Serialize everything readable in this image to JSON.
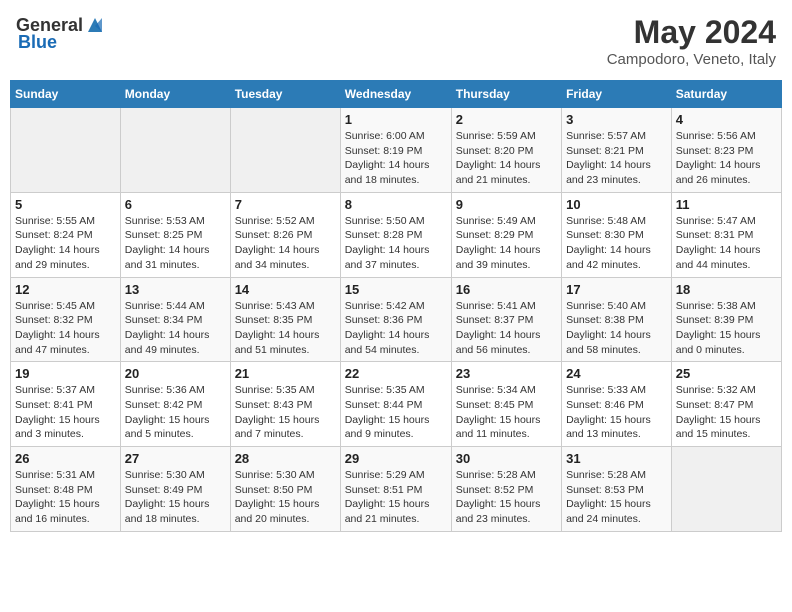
{
  "header": {
    "logo_general": "General",
    "logo_blue": "Blue",
    "title": "May 2024",
    "subtitle": "Campodoro, Veneto, Italy"
  },
  "weekdays": [
    "Sunday",
    "Monday",
    "Tuesday",
    "Wednesday",
    "Thursday",
    "Friday",
    "Saturday"
  ],
  "weeks": [
    [
      {
        "day": "",
        "info": ""
      },
      {
        "day": "",
        "info": ""
      },
      {
        "day": "",
        "info": ""
      },
      {
        "day": "1",
        "info": "Sunrise: 6:00 AM\nSunset: 8:19 PM\nDaylight: 14 hours\nand 18 minutes."
      },
      {
        "day": "2",
        "info": "Sunrise: 5:59 AM\nSunset: 8:20 PM\nDaylight: 14 hours\nand 21 minutes."
      },
      {
        "day": "3",
        "info": "Sunrise: 5:57 AM\nSunset: 8:21 PM\nDaylight: 14 hours\nand 23 minutes."
      },
      {
        "day": "4",
        "info": "Sunrise: 5:56 AM\nSunset: 8:23 PM\nDaylight: 14 hours\nand 26 minutes."
      }
    ],
    [
      {
        "day": "5",
        "info": "Sunrise: 5:55 AM\nSunset: 8:24 PM\nDaylight: 14 hours\nand 29 minutes."
      },
      {
        "day": "6",
        "info": "Sunrise: 5:53 AM\nSunset: 8:25 PM\nDaylight: 14 hours\nand 31 minutes."
      },
      {
        "day": "7",
        "info": "Sunrise: 5:52 AM\nSunset: 8:26 PM\nDaylight: 14 hours\nand 34 minutes."
      },
      {
        "day": "8",
        "info": "Sunrise: 5:50 AM\nSunset: 8:28 PM\nDaylight: 14 hours\nand 37 minutes."
      },
      {
        "day": "9",
        "info": "Sunrise: 5:49 AM\nSunset: 8:29 PM\nDaylight: 14 hours\nand 39 minutes."
      },
      {
        "day": "10",
        "info": "Sunrise: 5:48 AM\nSunset: 8:30 PM\nDaylight: 14 hours\nand 42 minutes."
      },
      {
        "day": "11",
        "info": "Sunrise: 5:47 AM\nSunset: 8:31 PM\nDaylight: 14 hours\nand 44 minutes."
      }
    ],
    [
      {
        "day": "12",
        "info": "Sunrise: 5:45 AM\nSunset: 8:32 PM\nDaylight: 14 hours\nand 47 minutes."
      },
      {
        "day": "13",
        "info": "Sunrise: 5:44 AM\nSunset: 8:34 PM\nDaylight: 14 hours\nand 49 minutes."
      },
      {
        "day": "14",
        "info": "Sunrise: 5:43 AM\nSunset: 8:35 PM\nDaylight: 14 hours\nand 51 minutes."
      },
      {
        "day": "15",
        "info": "Sunrise: 5:42 AM\nSunset: 8:36 PM\nDaylight: 14 hours\nand 54 minutes."
      },
      {
        "day": "16",
        "info": "Sunrise: 5:41 AM\nSunset: 8:37 PM\nDaylight: 14 hours\nand 56 minutes."
      },
      {
        "day": "17",
        "info": "Sunrise: 5:40 AM\nSunset: 8:38 PM\nDaylight: 14 hours\nand 58 minutes."
      },
      {
        "day": "18",
        "info": "Sunrise: 5:38 AM\nSunset: 8:39 PM\nDaylight: 15 hours\nand 0 minutes."
      }
    ],
    [
      {
        "day": "19",
        "info": "Sunrise: 5:37 AM\nSunset: 8:41 PM\nDaylight: 15 hours\nand 3 minutes."
      },
      {
        "day": "20",
        "info": "Sunrise: 5:36 AM\nSunset: 8:42 PM\nDaylight: 15 hours\nand 5 minutes."
      },
      {
        "day": "21",
        "info": "Sunrise: 5:35 AM\nSunset: 8:43 PM\nDaylight: 15 hours\nand 7 minutes."
      },
      {
        "day": "22",
        "info": "Sunrise: 5:35 AM\nSunset: 8:44 PM\nDaylight: 15 hours\nand 9 minutes."
      },
      {
        "day": "23",
        "info": "Sunrise: 5:34 AM\nSunset: 8:45 PM\nDaylight: 15 hours\nand 11 minutes."
      },
      {
        "day": "24",
        "info": "Sunrise: 5:33 AM\nSunset: 8:46 PM\nDaylight: 15 hours\nand 13 minutes."
      },
      {
        "day": "25",
        "info": "Sunrise: 5:32 AM\nSunset: 8:47 PM\nDaylight: 15 hours\nand 15 minutes."
      }
    ],
    [
      {
        "day": "26",
        "info": "Sunrise: 5:31 AM\nSunset: 8:48 PM\nDaylight: 15 hours\nand 16 minutes."
      },
      {
        "day": "27",
        "info": "Sunrise: 5:30 AM\nSunset: 8:49 PM\nDaylight: 15 hours\nand 18 minutes."
      },
      {
        "day": "28",
        "info": "Sunrise: 5:30 AM\nSunset: 8:50 PM\nDaylight: 15 hours\nand 20 minutes."
      },
      {
        "day": "29",
        "info": "Sunrise: 5:29 AM\nSunset: 8:51 PM\nDaylight: 15 hours\nand 21 minutes."
      },
      {
        "day": "30",
        "info": "Sunrise: 5:28 AM\nSunset: 8:52 PM\nDaylight: 15 hours\nand 23 minutes."
      },
      {
        "day": "31",
        "info": "Sunrise: 5:28 AM\nSunset: 8:53 PM\nDaylight: 15 hours\nand 24 minutes."
      },
      {
        "day": "",
        "info": ""
      }
    ]
  ]
}
